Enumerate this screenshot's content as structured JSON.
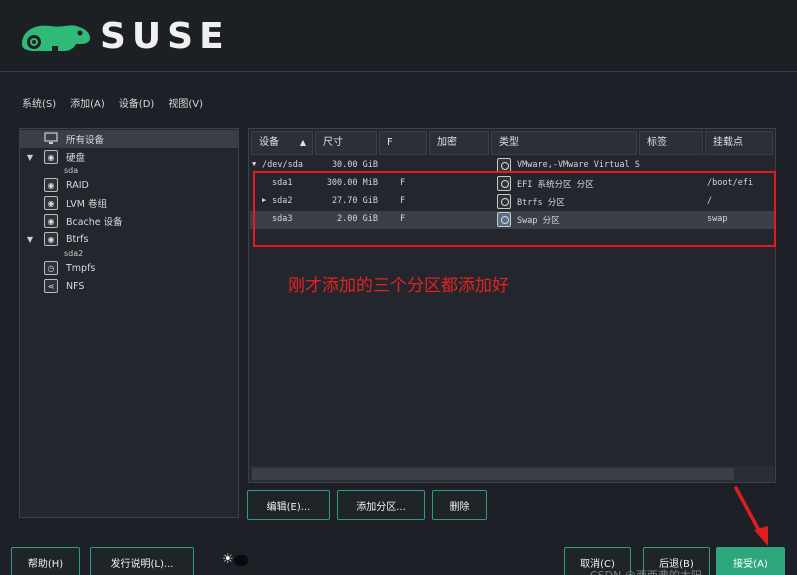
{
  "header": {
    "brand": "SUSE"
  },
  "menu": [
    "系统(S)",
    "添加(A)",
    "设备(D)",
    "视图(V)"
  ],
  "tree": {
    "items": [
      {
        "label": "所有设备",
        "icon": "monitor-icon"
      },
      {
        "label": "硬盘",
        "icon": "disk-icon",
        "child": "sda"
      },
      {
        "label": "RAID",
        "icon": "disk-icon"
      },
      {
        "label": "LVM 卷组",
        "icon": "disk-icon"
      },
      {
        "label": "Bcache 设备",
        "icon": "disk-icon"
      },
      {
        "label": "Btrfs",
        "icon": "disk-icon",
        "child": "sda2"
      },
      {
        "label": "Tmpfs",
        "icon": "clock-icon"
      },
      {
        "label": "NFS",
        "icon": "share-icon"
      }
    ]
  },
  "table": {
    "headers": [
      "设备",
      "尺寸",
      "F",
      "加密",
      "类型",
      "标签",
      "挂载点"
    ],
    "rows": [
      {
        "device": "/dev/sda",
        "size": "30.00 GiB",
        "f": "",
        "type": "VMware,-VMware Virtual S",
        "label": "",
        "mount": ""
      },
      {
        "device": "sda1",
        "size": "300.00 MiB",
        "f": "F",
        "type": "EFI 系统分区 分区",
        "label": "",
        "mount": "/boot/efi"
      },
      {
        "device": "sda2",
        "size": "27.70 GiB",
        "f": "F",
        "type": "Btrfs 分区",
        "label": "",
        "mount": "/"
      },
      {
        "device": "sda3",
        "size": "2.00 GiB",
        "f": "F",
        "type": "Swap 分区",
        "label": "",
        "mount": "swap"
      }
    ]
  },
  "annotation": {
    "text": "刚才添加的三个分区都添加好"
  },
  "table_buttons": {
    "edit": "编辑(E)...",
    "add_partition": "添加分区...",
    "delete": "删除"
  },
  "footer": {
    "help": "帮助(H)",
    "release_notes": "发行说明(L)...",
    "cancel": "取消(C)",
    "back": "后退(B)",
    "accept": "接受(A)",
    "watermark": "CSDN @西西弗的太阳"
  },
  "colors": {
    "accent": "#2fa77c",
    "annotation": "#e11c1c"
  }
}
